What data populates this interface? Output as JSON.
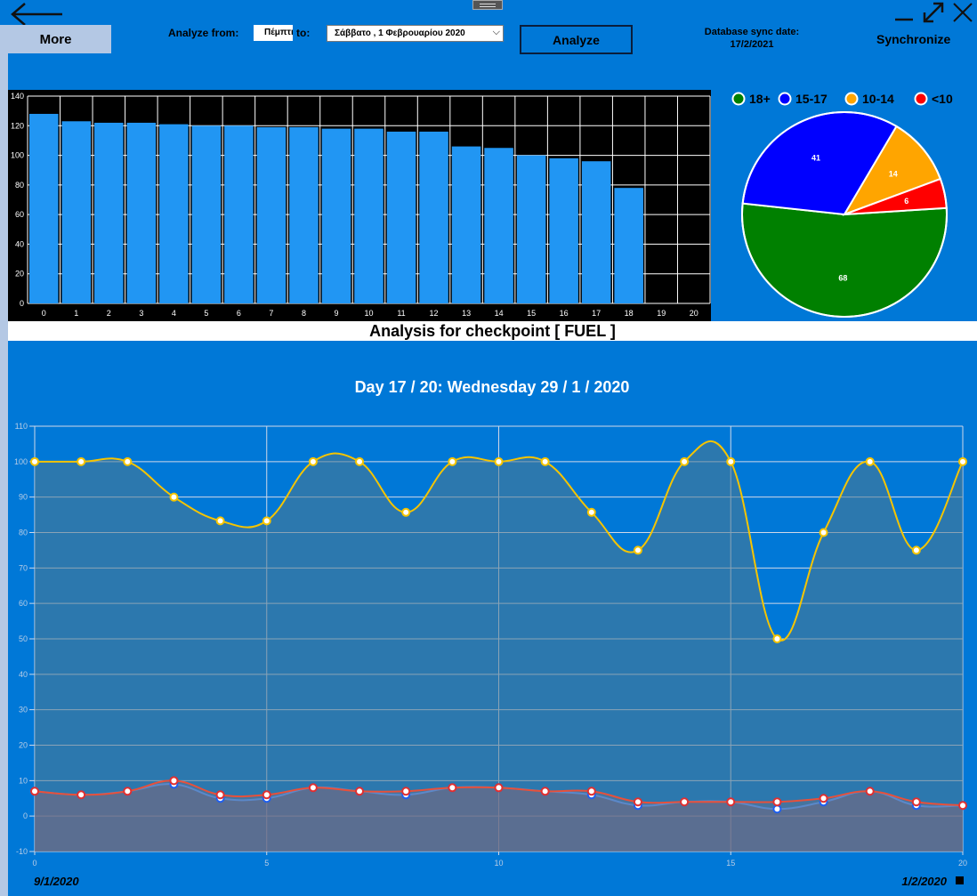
{
  "toolbar": {
    "more_label": "More",
    "analyze_from_label": "Analyze from:",
    "from_value": "Πέμπτη",
    "to_label": "to:",
    "to_value": "Σάββατο   ,   1 Φεβρουαρίου 2020",
    "analyze_label": "Analyze",
    "sync_date_label": "Database sync date:",
    "sync_date_value": "17/2/2021",
    "synchronize_label": "Synchronize"
  },
  "section_title": "Analysis for checkpoint [ FUEL ]",
  "chart_data": [
    {
      "type": "bar",
      "categories": [
        "0",
        "1",
        "2",
        "3",
        "4",
        "5",
        "6",
        "7",
        "8",
        "9",
        "10",
        "11",
        "12",
        "13",
        "14",
        "15",
        "16",
        "17",
        "18",
        "19",
        "20"
      ],
      "values": [
        128,
        123,
        122,
        122,
        121,
        120,
        120,
        119,
        119,
        118,
        118,
        116,
        116,
        106,
        105,
        100,
        98,
        96,
        78,
        null,
        null
      ],
      "ylim": [
        0,
        140
      ],
      "yticks": [
        0,
        20,
        40,
        60,
        80,
        100,
        120,
        140
      ],
      "grid": true,
      "colors": {
        "bar": "#2196f3",
        "background": "#000000",
        "grid": "#ffffff"
      }
    },
    {
      "type": "pie",
      "legend_position": "top",
      "slices": [
        {
          "label": "18+",
          "value": 68,
          "color": "#008000"
        },
        {
          "label": "15-17",
          "value": 41,
          "color": "#0000ff"
        },
        {
          "label": "10-14",
          "value": 14,
          "color": "#ffa500"
        },
        {
          "label": "<10",
          "value": 6,
          "color": "#ff0000"
        }
      ]
    },
    {
      "type": "area",
      "title": "Day 17 / 20: Wednesday 29 / 1 / 2020",
      "x": [
        0,
        1,
        2,
        3,
        4,
        5,
        6,
        7,
        8,
        9,
        10,
        11,
        12,
        13,
        14,
        15,
        16,
        17,
        18,
        19,
        20
      ],
      "xlim": [
        0,
        20
      ],
      "xticks": [
        0,
        5,
        10,
        15,
        20
      ],
      "ylim": [
        -10,
        110
      ],
      "yticks": [
        -10,
        0,
        10,
        20,
        30,
        40,
        50,
        60,
        70,
        80,
        90,
        100,
        110
      ],
      "grid": true,
      "start_date_label": "9/1/2020",
      "end_date_label": "1/2/2020",
      "series": [
        {
          "values": [
            100,
            100,
            100,
            90,
            83.3,
            83.3,
            100,
            100,
            85.7,
            100,
            100,
            100,
            85.7,
            75,
            100,
            100,
            50,
            80,
            100,
            75,
            100
          ],
          "color": "#f5c400",
          "marker_fill": "#ffffff",
          "marker_stroke": "#f5c400"
        },
        {
          "values": [
            7,
            6,
            7,
            9,
            5,
            5,
            8,
            7,
            6,
            8,
            8,
            7,
            6,
            3,
            4,
            4,
            2,
            4,
            7,
            3,
            3
          ],
          "color": "#5b88c9",
          "marker_fill": "#ffffff",
          "marker_stroke": "#1e5ff0"
        },
        {
          "values": [
            7,
            6,
            7,
            10,
            6,
            6,
            8,
            7,
            7,
            8,
            8,
            7,
            7,
            4,
            4,
            4,
            4,
            5,
            7,
            4,
            3
          ],
          "color": "#e8503a",
          "marker_fill": "#ffffff",
          "marker_stroke": "#e03030"
        }
      ]
    }
  ]
}
